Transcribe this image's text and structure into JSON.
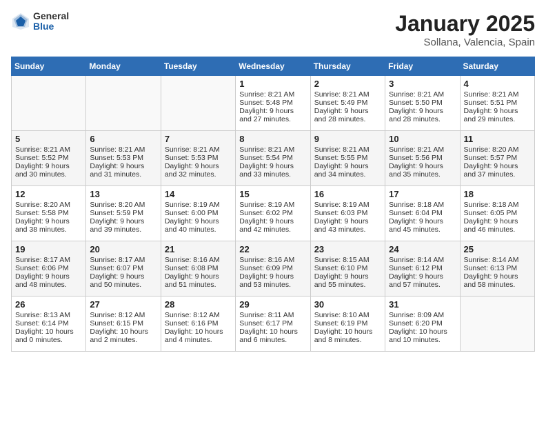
{
  "logo": {
    "general": "General",
    "blue": "Blue"
  },
  "header": {
    "title": "January 2025",
    "subtitle": "Sollana, Valencia, Spain"
  },
  "weekdays": [
    "Sunday",
    "Monday",
    "Tuesday",
    "Wednesday",
    "Thursday",
    "Friday",
    "Saturday"
  ],
  "weeks": [
    [
      {
        "day": "",
        "sunrise": "",
        "sunset": "",
        "daylight": ""
      },
      {
        "day": "",
        "sunrise": "",
        "sunset": "",
        "daylight": ""
      },
      {
        "day": "",
        "sunrise": "",
        "sunset": "",
        "daylight": ""
      },
      {
        "day": "1",
        "sunrise": "Sunrise: 8:21 AM",
        "sunset": "Sunset: 5:48 PM",
        "daylight": "Daylight: 9 hours and 27 minutes."
      },
      {
        "day": "2",
        "sunrise": "Sunrise: 8:21 AM",
        "sunset": "Sunset: 5:49 PM",
        "daylight": "Daylight: 9 hours and 28 minutes."
      },
      {
        "day": "3",
        "sunrise": "Sunrise: 8:21 AM",
        "sunset": "Sunset: 5:50 PM",
        "daylight": "Daylight: 9 hours and 28 minutes."
      },
      {
        "day": "4",
        "sunrise": "Sunrise: 8:21 AM",
        "sunset": "Sunset: 5:51 PM",
        "daylight": "Daylight: 9 hours and 29 minutes."
      }
    ],
    [
      {
        "day": "5",
        "sunrise": "Sunrise: 8:21 AM",
        "sunset": "Sunset: 5:52 PM",
        "daylight": "Daylight: 9 hours and 30 minutes."
      },
      {
        "day": "6",
        "sunrise": "Sunrise: 8:21 AM",
        "sunset": "Sunset: 5:53 PM",
        "daylight": "Daylight: 9 hours and 31 minutes."
      },
      {
        "day": "7",
        "sunrise": "Sunrise: 8:21 AM",
        "sunset": "Sunset: 5:53 PM",
        "daylight": "Daylight: 9 hours and 32 minutes."
      },
      {
        "day": "8",
        "sunrise": "Sunrise: 8:21 AM",
        "sunset": "Sunset: 5:54 PM",
        "daylight": "Daylight: 9 hours and 33 minutes."
      },
      {
        "day": "9",
        "sunrise": "Sunrise: 8:21 AM",
        "sunset": "Sunset: 5:55 PM",
        "daylight": "Daylight: 9 hours and 34 minutes."
      },
      {
        "day": "10",
        "sunrise": "Sunrise: 8:21 AM",
        "sunset": "Sunset: 5:56 PM",
        "daylight": "Daylight: 9 hours and 35 minutes."
      },
      {
        "day": "11",
        "sunrise": "Sunrise: 8:20 AM",
        "sunset": "Sunset: 5:57 PM",
        "daylight": "Daylight: 9 hours and 37 minutes."
      }
    ],
    [
      {
        "day": "12",
        "sunrise": "Sunrise: 8:20 AM",
        "sunset": "Sunset: 5:58 PM",
        "daylight": "Daylight: 9 hours and 38 minutes."
      },
      {
        "day": "13",
        "sunrise": "Sunrise: 8:20 AM",
        "sunset": "Sunset: 5:59 PM",
        "daylight": "Daylight: 9 hours and 39 minutes."
      },
      {
        "day": "14",
        "sunrise": "Sunrise: 8:19 AM",
        "sunset": "Sunset: 6:00 PM",
        "daylight": "Daylight: 9 hours and 40 minutes."
      },
      {
        "day": "15",
        "sunrise": "Sunrise: 8:19 AM",
        "sunset": "Sunset: 6:02 PM",
        "daylight": "Daylight: 9 hours and 42 minutes."
      },
      {
        "day": "16",
        "sunrise": "Sunrise: 8:19 AM",
        "sunset": "Sunset: 6:03 PM",
        "daylight": "Daylight: 9 hours and 43 minutes."
      },
      {
        "day": "17",
        "sunrise": "Sunrise: 8:18 AM",
        "sunset": "Sunset: 6:04 PM",
        "daylight": "Daylight: 9 hours and 45 minutes."
      },
      {
        "day": "18",
        "sunrise": "Sunrise: 8:18 AM",
        "sunset": "Sunset: 6:05 PM",
        "daylight": "Daylight: 9 hours and 46 minutes."
      }
    ],
    [
      {
        "day": "19",
        "sunrise": "Sunrise: 8:17 AM",
        "sunset": "Sunset: 6:06 PM",
        "daylight": "Daylight: 9 hours and 48 minutes."
      },
      {
        "day": "20",
        "sunrise": "Sunrise: 8:17 AM",
        "sunset": "Sunset: 6:07 PM",
        "daylight": "Daylight: 9 hours and 50 minutes."
      },
      {
        "day": "21",
        "sunrise": "Sunrise: 8:16 AM",
        "sunset": "Sunset: 6:08 PM",
        "daylight": "Daylight: 9 hours and 51 minutes."
      },
      {
        "day": "22",
        "sunrise": "Sunrise: 8:16 AM",
        "sunset": "Sunset: 6:09 PM",
        "daylight": "Daylight: 9 hours and 53 minutes."
      },
      {
        "day": "23",
        "sunrise": "Sunrise: 8:15 AM",
        "sunset": "Sunset: 6:10 PM",
        "daylight": "Daylight: 9 hours and 55 minutes."
      },
      {
        "day": "24",
        "sunrise": "Sunrise: 8:14 AM",
        "sunset": "Sunset: 6:12 PM",
        "daylight": "Daylight: 9 hours and 57 minutes."
      },
      {
        "day": "25",
        "sunrise": "Sunrise: 8:14 AM",
        "sunset": "Sunset: 6:13 PM",
        "daylight": "Daylight: 9 hours and 58 minutes."
      }
    ],
    [
      {
        "day": "26",
        "sunrise": "Sunrise: 8:13 AM",
        "sunset": "Sunset: 6:14 PM",
        "daylight": "Daylight: 10 hours and 0 minutes."
      },
      {
        "day": "27",
        "sunrise": "Sunrise: 8:12 AM",
        "sunset": "Sunset: 6:15 PM",
        "daylight": "Daylight: 10 hours and 2 minutes."
      },
      {
        "day": "28",
        "sunrise": "Sunrise: 8:12 AM",
        "sunset": "Sunset: 6:16 PM",
        "daylight": "Daylight: 10 hours and 4 minutes."
      },
      {
        "day": "29",
        "sunrise": "Sunrise: 8:11 AM",
        "sunset": "Sunset: 6:17 PM",
        "daylight": "Daylight: 10 hours and 6 minutes."
      },
      {
        "day": "30",
        "sunrise": "Sunrise: 8:10 AM",
        "sunset": "Sunset: 6:19 PM",
        "daylight": "Daylight: 10 hours and 8 minutes."
      },
      {
        "day": "31",
        "sunrise": "Sunrise: 8:09 AM",
        "sunset": "Sunset: 6:20 PM",
        "daylight": "Daylight: 10 hours and 10 minutes."
      },
      {
        "day": "",
        "sunrise": "",
        "sunset": "",
        "daylight": ""
      }
    ]
  ]
}
